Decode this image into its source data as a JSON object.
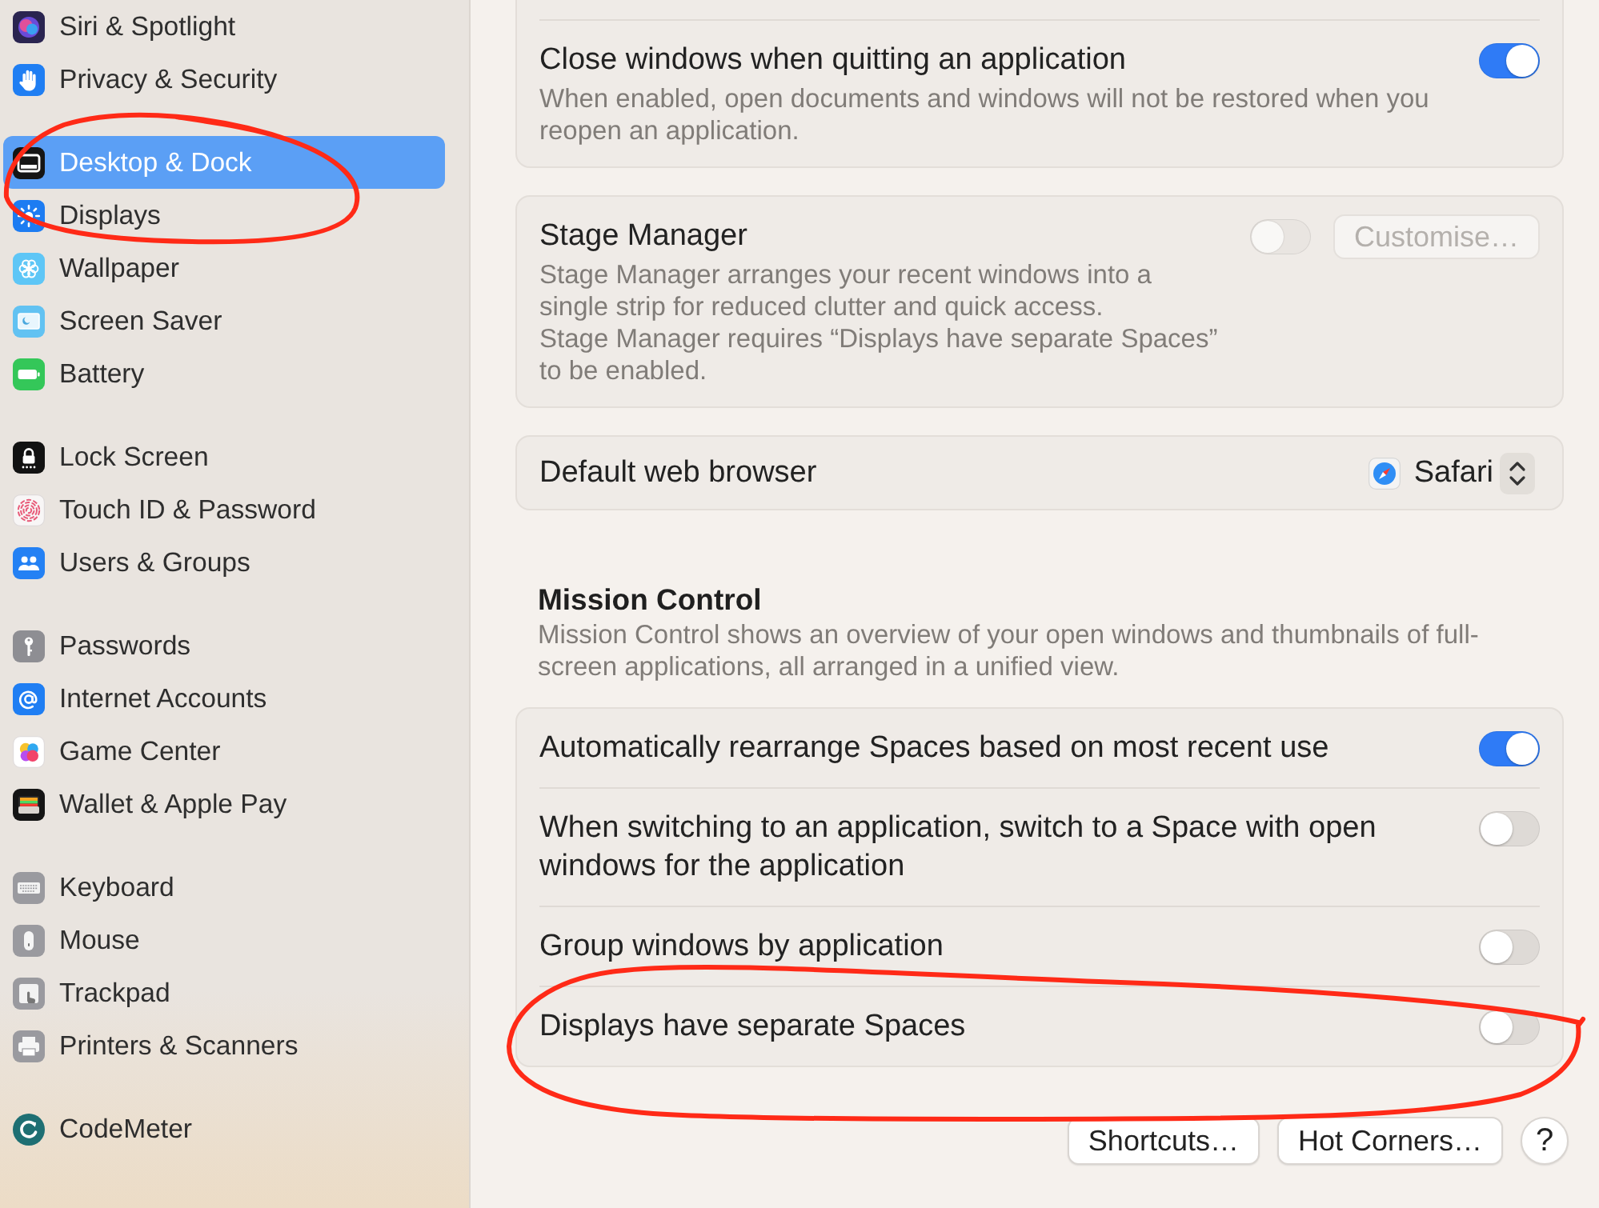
{
  "sidebar": {
    "groups": [
      {
        "items": [
          {
            "label": "Siri & Spotlight",
            "selected": false
          },
          {
            "label": "Privacy & Security",
            "selected": false
          }
        ]
      },
      {
        "items": [
          {
            "label": "Desktop & Dock",
            "selected": true
          },
          {
            "label": "Displays",
            "selected": false
          },
          {
            "label": "Wallpaper",
            "selected": false
          },
          {
            "label": "Screen Saver",
            "selected": false
          },
          {
            "label": "Battery",
            "selected": false
          }
        ]
      },
      {
        "items": [
          {
            "label": "Lock Screen",
            "selected": false
          },
          {
            "label": "Touch ID & Password",
            "selected": false
          },
          {
            "label": "Users & Groups",
            "selected": false
          }
        ]
      },
      {
        "items": [
          {
            "label": "Passwords",
            "selected": false
          },
          {
            "label": "Internet Accounts",
            "selected": false
          },
          {
            "label": "Game Center",
            "selected": false
          },
          {
            "label": "Wallet & Apple Pay",
            "selected": false
          }
        ]
      },
      {
        "items": [
          {
            "label": "Keyboard",
            "selected": false
          },
          {
            "label": "Mouse",
            "selected": false
          },
          {
            "label": "Trackpad",
            "selected": false
          },
          {
            "label": "Printers & Scanners",
            "selected": false
          }
        ]
      },
      {
        "items": [
          {
            "label": "CodeMeter",
            "selected": false
          }
        ]
      }
    ]
  },
  "content": {
    "sections": [
      {
        "rows": [
          {
            "kind": "toggle",
            "title": "Close windows when quitting an application",
            "description": [
              "When enabled, open documents and windows will not be restored when you reopen an application."
            ],
            "on": true,
            "disabled": false
          }
        ]
      },
      {
        "rows": [
          {
            "kind": "toggle",
            "title": "Stage Manager",
            "description": [
              "Stage Manager arranges your recent windows into a single strip for reduced clutter and quick access.",
              "Stage Manager requires “Displays have separate Spaces” to be enabled."
            ],
            "on": false,
            "disabled": true,
            "button": {
              "label": "Customise…",
              "disabled": true
            }
          }
        ]
      },
      {
        "rows": [
          {
            "kind": "popup",
            "title": "Default web browser",
            "value": "Safari"
          }
        ]
      },
      {
        "heading": "Mission Control",
        "description": [
          "Mission Control shows an overview of your open windows and thumbnails of full-screen applications, all arranged in a unified view."
        ],
        "rows": [
          {
            "kind": "toggle",
            "title": "Automatically rearrange Spaces based on most recent use",
            "on": true,
            "disabled": false
          },
          {
            "kind": "toggle",
            "title": "When switching to an application, switch to a Space with open windows for the application",
            "on": false,
            "disabled": false
          },
          {
            "kind": "toggle",
            "title": "Group windows by application",
            "on": false,
            "disabled": false
          },
          {
            "kind": "toggle",
            "title": "Displays have separate Spaces",
            "on": false,
            "disabled": false
          }
        ]
      }
    ],
    "buttons": [
      {
        "label": "Shortcuts…"
      },
      {
        "label": "Hot Corners…"
      }
    ],
    "help_button": {
      "label": "?"
    }
  }
}
